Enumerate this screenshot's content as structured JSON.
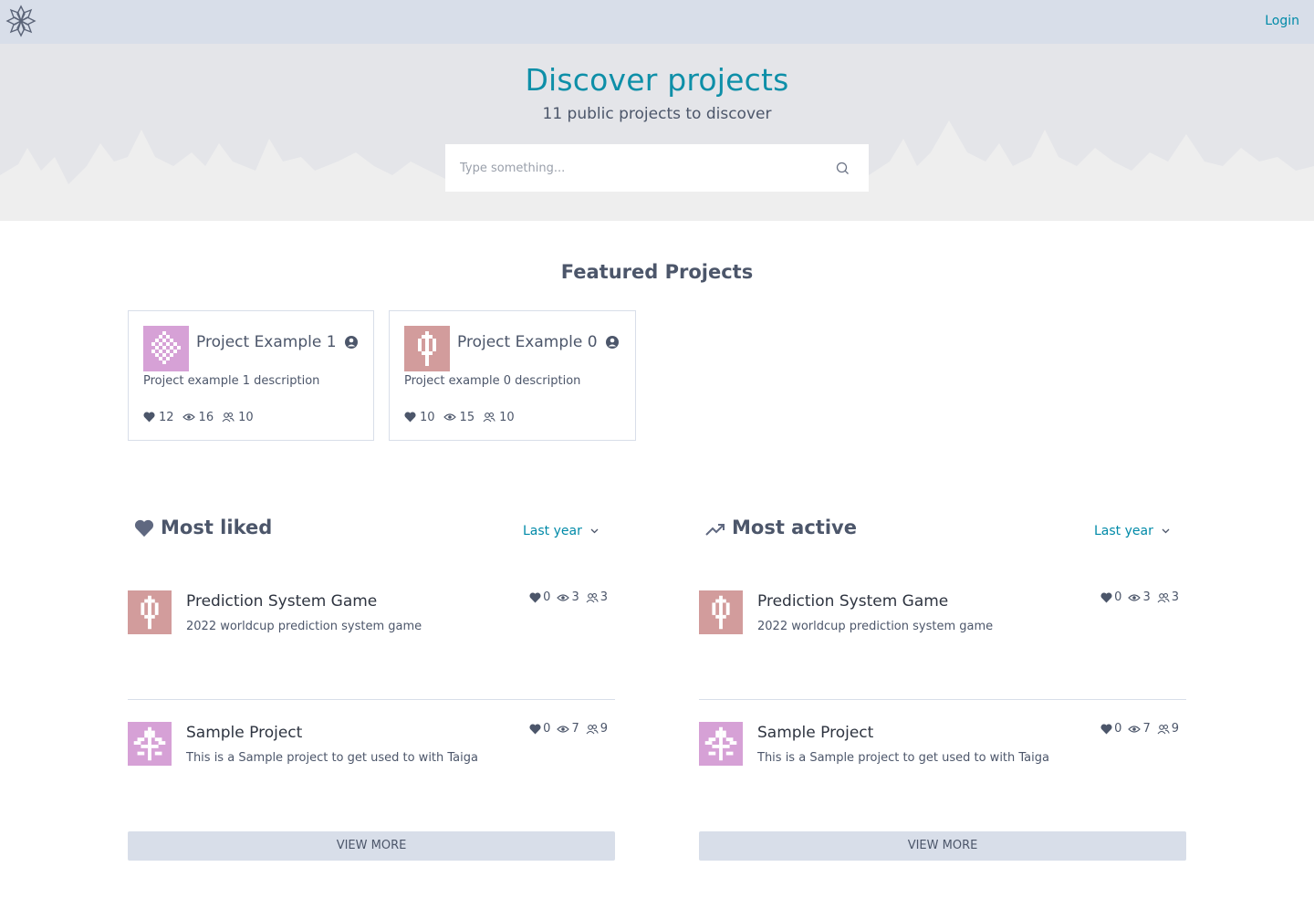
{
  "nav": {
    "login_label": "Login"
  },
  "hero": {
    "title": "Discover projects",
    "subtitle": "11 public projects to discover",
    "search_placeholder": "Type something..."
  },
  "featured": {
    "title": "Featured Projects",
    "projects": [
      {
        "name": "Project Example 1",
        "description": "Project example 1 description",
        "likes": "12",
        "watchers": "16",
        "members": "10",
        "thumb_color": "#d6a1d6"
      },
      {
        "name": "Project Example 0",
        "description": "Project example 0 description",
        "likes": "10",
        "watchers": "15",
        "members": "10",
        "thumb_color": "#d29c9c"
      }
    ]
  },
  "most_liked": {
    "title": "Most liked",
    "period": "Last year",
    "items": [
      {
        "name": "Prediction System Game",
        "description": "2022 worldcup prediction system game",
        "likes": "0",
        "watchers": "3",
        "members": "3"
      },
      {
        "name": "Sample Project",
        "description": "This is a Sample project to get used to with Taiga",
        "likes": "0",
        "watchers": "7",
        "members": "9"
      }
    ],
    "view_more": "VIEW MORE"
  },
  "most_active": {
    "title": "Most active",
    "period": "Last year",
    "items": [
      {
        "name": "Prediction System Game",
        "description": "2022 worldcup prediction system game",
        "likes": "0",
        "watchers": "3",
        "members": "3"
      },
      {
        "name": "Sample Project",
        "description": "This is a Sample project to get used to with Taiga",
        "likes": "0",
        "watchers": "7",
        "members": "9"
      }
    ],
    "view_more": "VIEW MORE"
  },
  "colors": {
    "accent": "#008aa8",
    "title": "#0e8fa8",
    "nav_bg": "#d8dee9",
    "hero_bg": "#e4e5e9",
    "text": "#4c566a"
  },
  "icons": [
    "logo-icon",
    "search-icon",
    "lock-icon",
    "heart-icon",
    "eye-icon",
    "members-icon",
    "trending-icon",
    "chevron-down-icon"
  ]
}
